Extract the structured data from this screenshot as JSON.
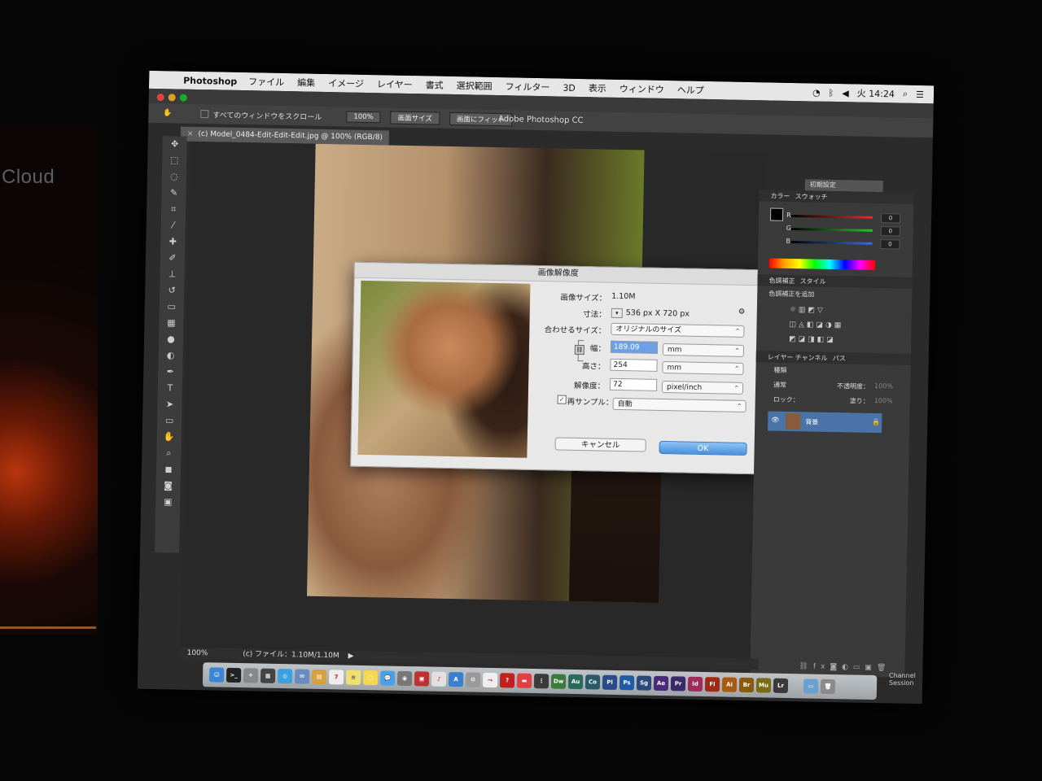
{
  "venue": {
    "brand_text": "Cloud"
  },
  "menubar": {
    "app": "Photoshop",
    "items": [
      "ファイル",
      "編集",
      "イメージ",
      "レイヤー",
      "書式",
      "選択範囲",
      "フィルター",
      "3D",
      "表示",
      "ウィンドウ",
      "ヘルプ"
    ],
    "clock": "火 14:24"
  },
  "window": {
    "title": "Adobe Photoshop CC"
  },
  "options_bar": {
    "scroll_all": "すべてのウィンドウをスクロール",
    "zoom_btn": "100%",
    "screen_size_btn": "画面サイズ",
    "fit_btn": "画面にフィット"
  },
  "document": {
    "tab_title": "(c) Model_0484-Edit-Edit-Edit.jpg @ 100% (RGB/8)"
  },
  "dialog": {
    "title": "画像解像度",
    "image_size_label": "画像サイズ：",
    "image_size_value": "1.10M",
    "dimensions_label": "寸法：",
    "dimensions_value": "536 px  X  720 px",
    "fit_label": "合わせるサイズ：",
    "fit_value": "オリジナルのサイズ",
    "width_label": "幅：",
    "width_value": "189.09",
    "width_unit": "mm",
    "height_label": "高さ：",
    "height_value": "254",
    "height_unit": "mm",
    "resolution_label": "解像度：",
    "resolution_value": "72",
    "resolution_unit": "pixel/inch",
    "resample_label": "再サンプル：",
    "resample_checked": true,
    "resample_value": "自動",
    "cancel": "キャンセル",
    "ok": "OK"
  },
  "panels": {
    "preset": "初期設定",
    "color_tabs": [
      "カラー",
      "スウォッチ"
    ],
    "channels": [
      {
        "label": "R",
        "value": "0",
        "color": "#e23030"
      },
      {
        "label": "G",
        "value": "0",
        "color": "#2fbf3a"
      },
      {
        "label": "B",
        "value": "0",
        "color": "#3a6be0"
      }
    ],
    "adjust_tabs": [
      "色調補正",
      "スタイル"
    ],
    "adjust_add": "色調補正を追加",
    "layer_tabs": [
      "レイヤー",
      "チャンネル",
      "パス"
    ],
    "kind_filter": "種類",
    "blend_mode": "通常",
    "opacity_label": "不透明度：",
    "opacity_value": "100%",
    "lock_label": "ロック：",
    "fill_label": "塗り：",
    "fill_value": "100%",
    "layer_name": "背景"
  },
  "status": {
    "zoom": "100%",
    "file_info": "(c) ファイル：1.10M/1.10M"
  },
  "dock": {
    "items": [
      {
        "label": "Dw",
        "color": "#3a7a3a"
      },
      {
        "label": "Au",
        "color": "#2a6a5a"
      },
      {
        "label": "Co",
        "color": "#2a5a6a"
      },
      {
        "label": "Pl",
        "color": "#2a4a8a"
      },
      {
        "label": "Ps",
        "color": "#1e5aa8"
      },
      {
        "label": "Sg",
        "color": "#2a4a7a"
      },
      {
        "label": "Ae",
        "color": "#4a2a7a"
      },
      {
        "label": "Pr",
        "color": "#3a2a6a"
      },
      {
        "label": "Id",
        "color": "#a02a5a"
      },
      {
        "label": "Fl",
        "color": "#a02a1a"
      },
      {
        "label": "Ai",
        "color": "#a85a10"
      },
      {
        "label": "Br",
        "color": "#8a5a10"
      },
      {
        "label": "Mu",
        "color": "#7a6a10"
      },
      {
        "label": "Lr",
        "color": "#3a3a3a"
      }
    ]
  },
  "overlay": {
    "channel_session": "Channel\nSession"
  }
}
